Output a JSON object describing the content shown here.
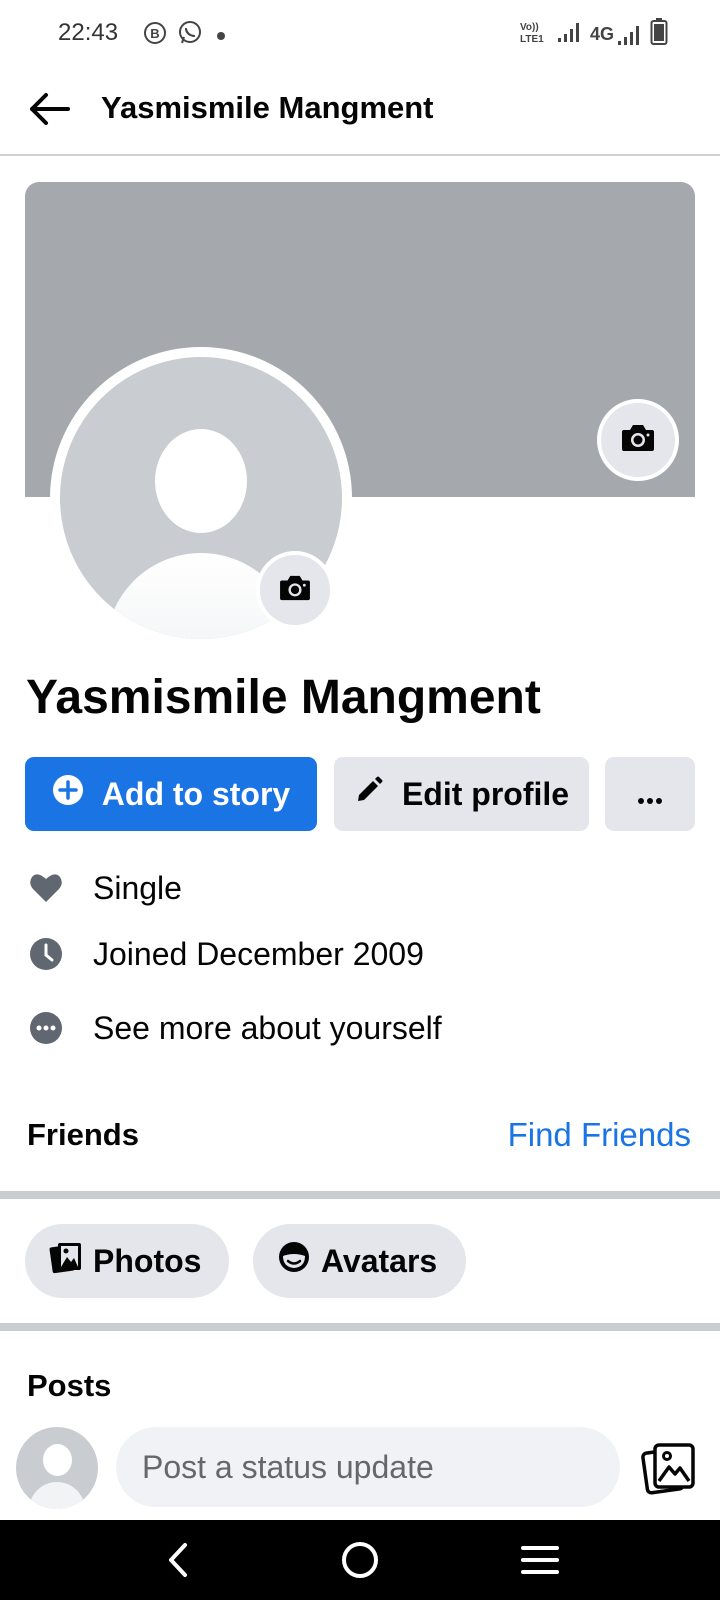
{
  "status_bar": {
    "time": "22:43",
    "left_icons": [
      "b-badge-icon",
      "whatsapp-icon",
      "dot-icon"
    ],
    "right_icons": [
      "volte-icon",
      "signal-icon",
      "signal-4g-icon",
      "battery-icon"
    ],
    "volte_label": "Vo)) LTE1",
    "network_label": "4G"
  },
  "header": {
    "title": "Yasmismile Mangment"
  },
  "profile": {
    "name": "Yasmismile Mangment"
  },
  "actions": {
    "add_story_label": "Add to story",
    "edit_profile_label": "Edit profile",
    "more_label": "···"
  },
  "details": [
    {
      "icon": "heart-icon",
      "text": "Single"
    },
    {
      "icon": "clock-icon",
      "text": "Joined December 2009"
    },
    {
      "icon": "more-circle-icon",
      "text": "See more about yourself"
    }
  ],
  "friends": {
    "label": "Friends",
    "find_label": "Find Friends"
  },
  "chips": {
    "photos_label": "Photos",
    "avatars_label": "Avatars"
  },
  "posts": {
    "label": "Posts",
    "composer_placeholder": "Post a status update"
  },
  "nav": {
    "icons": [
      "back-nav-icon",
      "home-nav-icon",
      "menu-nav-icon"
    ]
  },
  "colors": {
    "accent": "#1b74e4",
    "button_gray": "#e4e6eb",
    "cover_gray": "#a5a8ad",
    "text": "#050505"
  }
}
